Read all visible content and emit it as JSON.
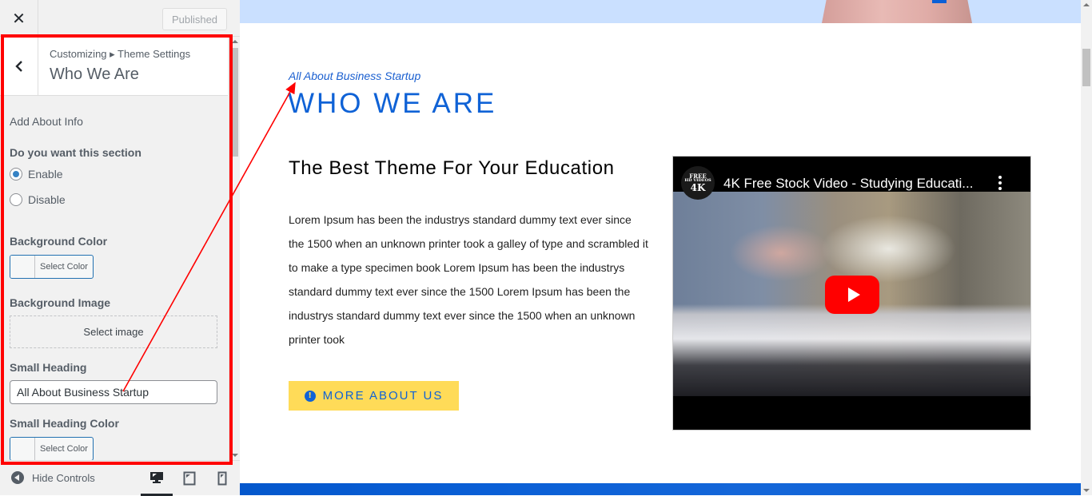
{
  "sidebar": {
    "close_label": "✕",
    "publish_label": "Published",
    "breadcrumb": "Customizing ▸ Theme Settings",
    "section_title": "Who We Are",
    "description": "Add About Info",
    "section_toggle": {
      "title": "Do you want this section",
      "options": [
        {
          "label": "Enable",
          "selected": true
        },
        {
          "label": "Disable",
          "selected": false
        }
      ]
    },
    "background_color": {
      "title": "Background Color",
      "button_label": "Select Color"
    },
    "background_image": {
      "title": "Background Image",
      "button_label": "Select image"
    },
    "small_heading": {
      "title": "Small Heading",
      "value": "All About Business Startup"
    },
    "small_heading_color": {
      "title": "Small Heading Color",
      "button_label": "Select Color"
    },
    "footer": {
      "hide_controls_label": "Hide Controls",
      "devices": [
        {
          "name": "desktop",
          "active": true
        },
        {
          "name": "tablet",
          "active": false
        },
        {
          "name": "mobile",
          "active": false
        }
      ]
    }
  },
  "preview": {
    "small_heading": "All About Business Startup",
    "heading": "WHO WE ARE",
    "subheading": "The Best Theme For Your Education",
    "body": "Lorem Ipsum has been the industrys standard dummy text ever since the 1500 when an unknown printer took a galley of type and scrambled it to make a type specimen book Lorem Ipsum has been the industrys standard dummy text ever since the 1500 Lorem Ipsum has been the industrys standard dummy text ever since the 1500 when an unknown printer took",
    "cta_label": "MORE ABOUT US",
    "cta_icon": "!",
    "video": {
      "title": "4K Free Stock Video - Studying Educati...",
      "channel_logo": {
        "line1": "FREE",
        "line2": "HD VIDEOS",
        "line3": "4K"
      }
    }
  },
  "colors": {
    "accent_blue": "#0f62d6",
    "cta_yellow": "#ffdb58",
    "highlight_red": "#ff0000",
    "youtube_red": "#ff0000"
  }
}
